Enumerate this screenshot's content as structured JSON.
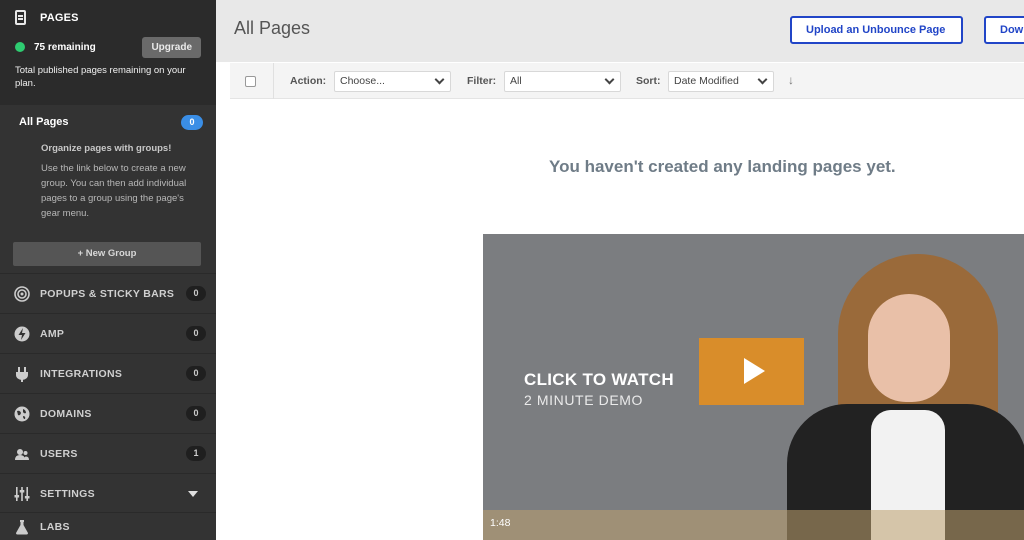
{
  "sidebar": {
    "pages_title": "PAGES",
    "remaining": "75 remaining",
    "upgrade_label": "Upgrade",
    "plan_note": "Total published pages remaining on your plan.",
    "all_pages_label": "All Pages",
    "all_pages_count": "0",
    "groups_title": "Organize pages with groups!",
    "groups_desc": "Use the link below to create a new group. You can then add individual pages to a group using the page's gear menu.",
    "new_group_label": "+ New Group",
    "nav": [
      {
        "label": "POPUPS & STICKY BARS",
        "count": "0",
        "icon": "target-icon"
      },
      {
        "label": "AMP",
        "count": "0",
        "icon": "bolt-icon"
      },
      {
        "label": "INTEGRATIONS",
        "count": "0",
        "icon": "plug-icon"
      },
      {
        "label": "DOMAINS",
        "count": "0",
        "icon": "globe-icon"
      },
      {
        "label": "USERS",
        "count": "1",
        "icon": "users-icon"
      },
      {
        "label": "SETTINGS",
        "icon": "sliders-icon"
      },
      {
        "label": "LABS",
        "icon": "flask-icon"
      }
    ]
  },
  "header": {
    "title": "All Pages",
    "upload_button": "Upload an Unbounce Page",
    "download_button": "Dow"
  },
  "toolbar": {
    "action_label": "Action:",
    "action_value": "Choose...",
    "filter_label": "Filter:",
    "filter_value": "All",
    "sort_label": "Sort:",
    "sort_value": "Date Modified",
    "sort_arrow": "↓"
  },
  "main": {
    "empty_message": "You haven't created any landing pages yet."
  },
  "video": {
    "cta_line1": "CLICK TO WATCH",
    "cta_line2": "2 MINUTE DEMO",
    "duration": "1:48"
  },
  "colors": {
    "sidebar_bg": "#333333",
    "accent_blue": "#2145c7",
    "badge_blue": "#3a8ee6",
    "status_green": "#2ecc71",
    "play_orange": "#d98d2a"
  }
}
